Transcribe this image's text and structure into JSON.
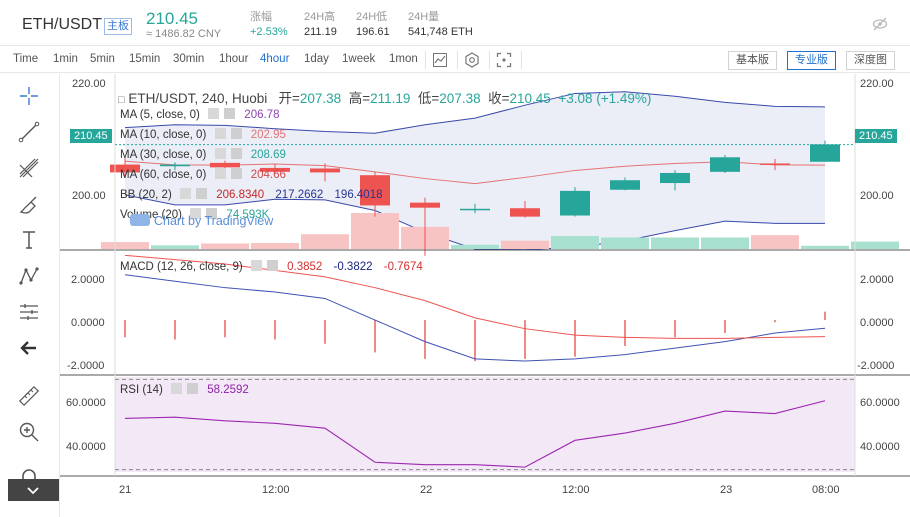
{
  "header": {
    "pair": "ETH/USDT",
    "badge": "主板",
    "price": "210.45",
    "price_cny": "≈ 1486.82 CNY",
    "stats": [
      {
        "label": "涨幅",
        "value": "+2.53%",
        "up": true
      },
      {
        "label": "24H高",
        "value": "211.19"
      },
      {
        "label": "24H低",
        "value": "196.61"
      },
      {
        "label": "24H量",
        "value": "541,748 ETH"
      }
    ]
  },
  "toolbar": {
    "intervals": [
      "Time",
      "1min",
      "5min",
      "15min",
      "30min",
      "1hour",
      "4hour",
      "1day",
      "1week",
      "1mon"
    ],
    "active_interval": "4hour",
    "view_buttons": [
      "基本版",
      "专业版",
      "深度图"
    ],
    "active_view": "专业版"
  },
  "left_tools": [
    "crosshair-icon",
    "trend-line-icon",
    "fib-icon",
    "brush-icon",
    "text-icon",
    "pattern-icon",
    "measure-icon",
    "back-arrow-icon",
    "ruler-icon",
    "zoom-in-icon",
    "magnet-icon"
  ],
  "legend": {
    "ohlc": {
      "title": "ETH/USDT, 240, Huobi",
      "open_label": "开=",
      "open": "207.38",
      "high_label": "高=",
      "high": "211.19",
      "low_label": "低=",
      "low": "207.38",
      "close_label": "收=",
      "close": "210.45",
      "change": "+3.08 (+1.49%)"
    },
    "ma5": {
      "name": "MA (5, close, 0)",
      "value": "206.78",
      "color": "#8e44ad"
    },
    "ma10": {
      "name": "MA (10, close, 0)",
      "value": "202.95",
      "color": "#e57373"
    },
    "ma30": {
      "name": "MA (30, close, 0)",
      "value": "208.69",
      "color": "#26a69a"
    },
    "ma60": {
      "name": "MA (60, close, 0)",
      "value": "204.66",
      "color": "#d04a4a"
    },
    "bb": {
      "name": "BB (20, 2)",
      "mid": "206.8340",
      "upper": "217.2662",
      "lower": "196.4018"
    },
    "volume": {
      "name": "Volume (20)",
      "value": "74.593K"
    },
    "watermark": "Chart by TradingView",
    "macd": {
      "name": "MACD (12, 26, close, 9)",
      "hist": "0.3852",
      "macd": "-0.3822",
      "signal": "-0.7674"
    },
    "rsi": {
      "name": "RSI (14)",
      "value": "58.2592"
    }
  },
  "axes": {
    "price_ticks": [
      "220.00",
      "200.00"
    ],
    "price_tag": "210.45",
    "macd_ticks": [
      "2.0000",
      "0.0000",
      "-2.0000"
    ],
    "rsi_ticks": [
      "60.0000",
      "40.0000"
    ],
    "time_ticks": [
      "21",
      "12:00",
      "22",
      "12:00",
      "23",
      "08:00"
    ]
  },
  "chart_data": {
    "type": "candlestick",
    "candles": [
      {
        "open": 206.9,
        "high": 208.1,
        "low": 204.6,
        "close": 205.5
      },
      {
        "open": 206.6,
        "high": 207.3,
        "low": 205.9,
        "close": 206.9
      },
      {
        "open": 207.2,
        "high": 207.6,
        "low": 206.1,
        "close": 206.4
      },
      {
        "open": 206.3,
        "high": 207.0,
        "low": 205.3,
        "close": 205.6
      },
      {
        "open": 206.2,
        "high": 207.1,
        "low": 203.9,
        "close": 205.5
      },
      {
        "open": 205.0,
        "high": 205.6,
        "low": 197.6,
        "close": 199.6
      },
      {
        "open": 200.1,
        "high": 201.0,
        "low": 190.6,
        "close": 199.2
      },
      {
        "open": 199.0,
        "high": 199.9,
        "low": 198.2,
        "close": 199.0
      },
      {
        "open": 199.1,
        "high": 200.4,
        "low": 197.4,
        "close": 197.6
      },
      {
        "open": 197.8,
        "high": 202.9,
        "low": 197.6,
        "close": 202.2
      },
      {
        "open": 202.4,
        "high": 204.6,
        "low": 202.3,
        "close": 204.1
      },
      {
        "open": 203.6,
        "high": 205.9,
        "low": 202.3,
        "close": 205.4
      },
      {
        "open": 205.6,
        "high": 208.6,
        "low": 205.4,
        "close": 208.2
      },
      {
        "open": 207.1,
        "high": 207.9,
        "low": 205.9,
        "close": 206.9
      },
      {
        "open": 207.4,
        "high": 211.2,
        "low": 207.4,
        "close": 210.5
      }
    ],
    "volume": [
      15,
      8,
      12,
      13,
      32,
      78,
      48,
      9,
      18,
      28,
      25,
      25,
      25,
      30,
      7,
      16
    ],
    "bb_upper": [
      213.5,
      214.0,
      213.9,
      213.3,
      212.8,
      212.5,
      214.0,
      215.2,
      217.5,
      219.6,
      219.9,
      219.1,
      218.0,
      217.3,
      217.2
    ],
    "bb_lower": [
      201.5,
      199.7,
      199.7,
      200.7,
      200.6,
      198.7,
      194.8,
      191.8,
      191.7,
      192.1,
      193.3,
      195.1,
      196.8,
      196.4,
      196.4
    ],
    "macd_hist": [
      -0.8,
      -0.9,
      -0.8,
      -0.9,
      -1.1,
      -1.5,
      -1.8,
      -1.9,
      -1.8,
      -1.7,
      -1.2,
      -0.8,
      -0.6,
      -0.1,
      0.39
    ],
    "macd_line": [
      2.1,
      1.8,
      1.5,
      1.3,
      1.0,
      0.0,
      -1.0,
      -1.8,
      -1.9,
      -1.8,
      -1.6,
      -1.3,
      -1.0,
      -0.6,
      -0.38
    ],
    "signal_line": [
      3.0,
      2.8,
      2.6,
      2.3,
      2.0,
      1.5,
      0.9,
      0.1,
      -0.4,
      -0.7,
      -0.8,
      -0.85,
      -0.85,
      -0.8,
      -0.77
    ],
    "rsi": [
      51,
      51.5,
      50,
      49,
      47,
      33,
      32,
      32,
      31,
      42,
      45,
      49,
      54,
      53,
      58.26
    ],
    "price_range": [
      192.0,
      222.0
    ],
    "macd_range": [
      -2.5,
      3.2
    ],
    "rsi_range": [
      29,
      68
    ]
  }
}
